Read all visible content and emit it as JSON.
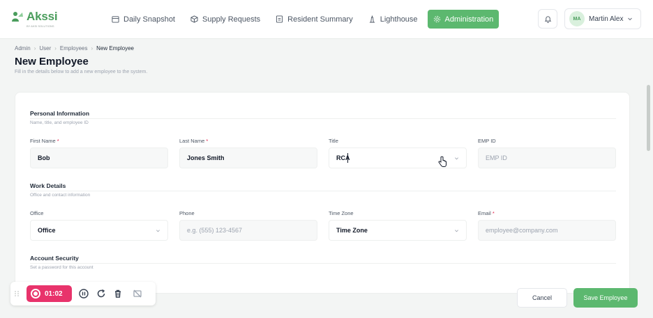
{
  "app": {
    "logo_text": "Akssi",
    "logo_tagline": "BY AKSI SOLUTIONS",
    "brand_color": "#5cb86f"
  },
  "nav": {
    "items": [
      {
        "label": "Daily Snapshot",
        "icon": "calendar-icon"
      },
      {
        "label": "Supply Requests",
        "icon": "box-icon"
      },
      {
        "label": "Resident Summary",
        "icon": "document-icon"
      },
      {
        "label": "Lighthouse",
        "icon": "lighthouse-icon"
      },
      {
        "label": "Administration",
        "icon": "gear-icon",
        "active": true
      }
    ]
  },
  "user": {
    "initials": "MA",
    "name": "Martin Alex"
  },
  "breadcrumb": [
    "Admin",
    "User",
    "Employees",
    "New Employee"
  ],
  "page": {
    "title": "New Employee",
    "subtitle": "Fill in the details below to add a new employee to the system."
  },
  "sections": {
    "personal": {
      "title": "Personal Information",
      "subtitle": "Name, title, and employee ID"
    },
    "work": {
      "title": "Work Details",
      "subtitle": "Office and contact information"
    },
    "security": {
      "title": "Account Security",
      "subtitle": "Set a password for this account"
    }
  },
  "fields": {
    "first_name": {
      "label": "First Name",
      "required": "*",
      "value": "Bob"
    },
    "last_name": {
      "label": "Last Name",
      "required": "*",
      "value": "Jones Smith"
    },
    "title": {
      "label": "Title",
      "value": "RCA"
    },
    "emp_id": {
      "label": "EMP ID",
      "placeholder": "EMP ID"
    },
    "office": {
      "label": "Office",
      "value": "Office"
    },
    "phone": {
      "label": "Phone",
      "placeholder": "e.g. (555) 123-4567"
    },
    "time_zone": {
      "label": "Time Zone",
      "value": "Time Zone"
    },
    "email": {
      "label": "Email",
      "required": "*",
      "placeholder": "employee@company.com"
    }
  },
  "recorder": {
    "time": "01:02",
    "accent": "#e8336b"
  },
  "actions": {
    "cancel": "Cancel",
    "save": "Save Employee"
  }
}
